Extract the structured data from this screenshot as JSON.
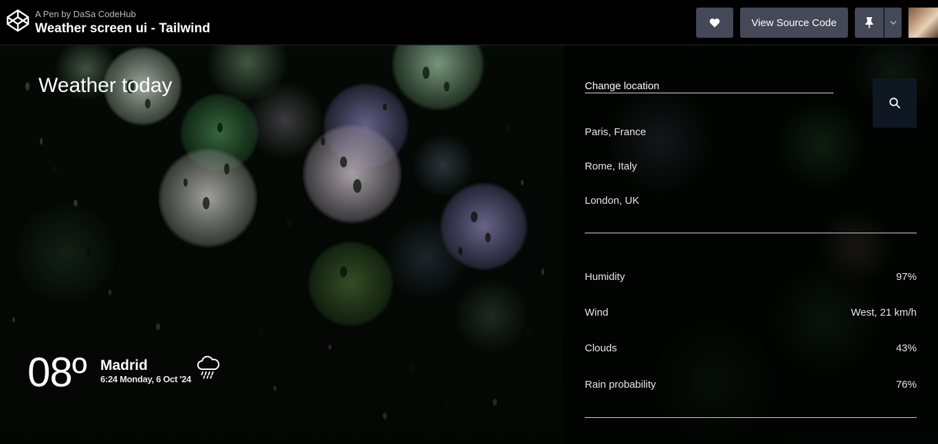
{
  "codepen": {
    "byline": "A Pen by DaSa CodeHub",
    "title": "Weather screen ui - Tailwind",
    "view_source_label": "View Source Code"
  },
  "weather": {
    "heading": "Weather today",
    "temperature": "08º",
    "city": "Madrid",
    "datetime": "6:24 Monday, 6 Oct '24",
    "condition_icon": "rain-cloud-icon"
  },
  "search": {
    "placeholder": "Change location",
    "locations": [
      "Paris, France",
      "Rome, Italy",
      "London, UK"
    ]
  },
  "details": [
    {
      "label": "Humidity",
      "value": "97%"
    },
    {
      "label": "Wind",
      "value": "West, 21 km/h"
    },
    {
      "label": "Clouds",
      "value": "43%"
    },
    {
      "label": "Rain probability",
      "value": "76%"
    }
  ],
  "colors": {
    "topbar_bg": "#000000",
    "button_bg": "#444857",
    "search_button_bg": "#0f1722"
  }
}
